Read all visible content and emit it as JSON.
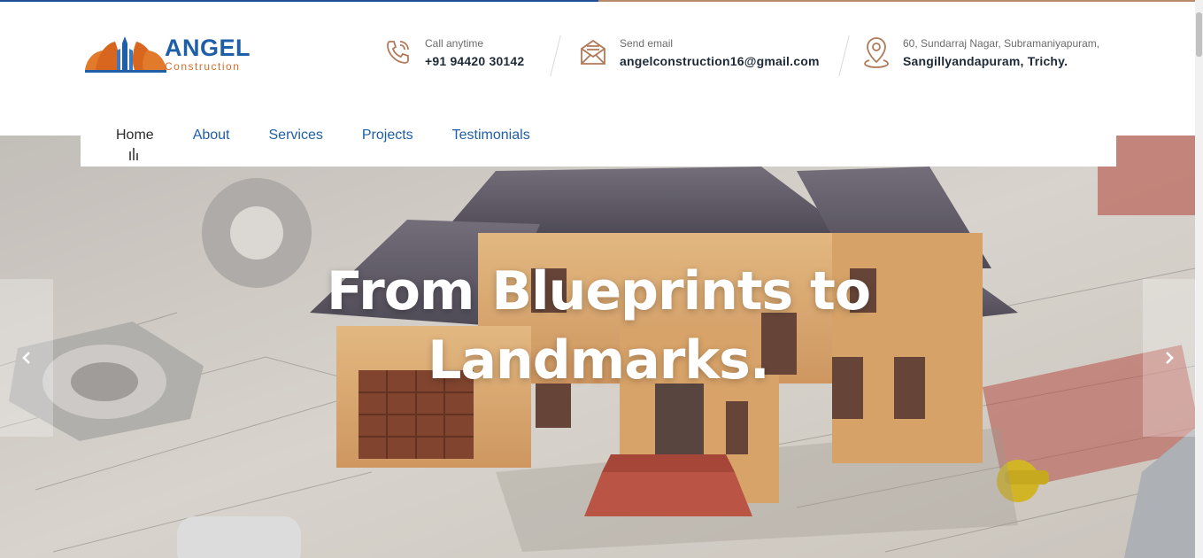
{
  "logo": {
    "brand": "ANGEL",
    "sub": "Construction"
  },
  "contact": {
    "call": {
      "label": "Call anytime",
      "value": "+91 94420 30142",
      "icon": "phone-icon"
    },
    "email": {
      "label": "Send email",
      "value": "angelconstruction16@gmail.com",
      "icon": "envelope-icon"
    },
    "address": {
      "line1": "60, Sundarraj Nagar, Subramaniyapuram,",
      "line2": "Sangillyandapuram, Trichy.",
      "icon": "map-pin-icon"
    }
  },
  "nav": {
    "items": [
      {
        "label": "Home",
        "active": true
      },
      {
        "label": "About"
      },
      {
        "label": "Services"
      },
      {
        "label": "Projects"
      },
      {
        "label": "Testimonials"
      }
    ]
  },
  "hero": {
    "headline_line1": "From Blueprints to",
    "headline_line2": "Landmarks.",
    "prev_icon": "chevron-left-icon",
    "next_icon": "chevron-right-icon"
  },
  "colors": {
    "brand_blue": "#1f5fa8",
    "brand_orange": "#d26c2b",
    "accent_brown": "#b07a5a",
    "top_line_left": "#1f4f94",
    "top_line_right": "#b88a6a"
  }
}
